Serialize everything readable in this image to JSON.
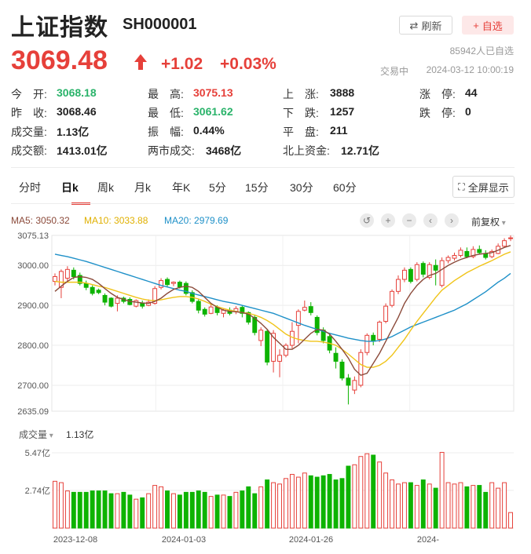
{
  "header": {
    "title": "上证指数",
    "code": "SH000001",
    "refresh_label": "刷新",
    "fav_label": "自选",
    "subscribers": "85942人已自选"
  },
  "quote": {
    "price": "3069.48",
    "change": "+1.02",
    "change_pct": "+0.03%",
    "status": "交易中",
    "timestamp": "2024-03-12 10:00:19"
  },
  "stats": [
    [
      {
        "label": "今　开:",
        "value": "3068.18",
        "color": "dn"
      },
      {
        "label": "最　高:",
        "value": "3075.13",
        "color": "up"
      },
      {
        "label": "上　涨:",
        "value": "3888",
        "color": ""
      },
      {
        "label": "涨　停:",
        "value": "44",
        "color": ""
      }
    ],
    [
      {
        "label": "昨　收:",
        "value": "3068.46",
        "color": ""
      },
      {
        "label": "最　低:",
        "value": "3061.62",
        "color": "dn"
      },
      {
        "label": "下　跌:",
        "value": "1257",
        "color": ""
      },
      {
        "label": "跌　停:",
        "value": "0",
        "color": ""
      }
    ],
    [
      {
        "label": "成交量:",
        "value": "1.13亿",
        "color": ""
      },
      {
        "label": "振　幅:",
        "value": "0.44%",
        "color": ""
      },
      {
        "label": "平　盘:",
        "value": "211",
        "color": ""
      }
    ],
    [
      {
        "label": "成交额:",
        "value": "1413.01亿",
        "color": ""
      },
      {
        "label": "两市成交:",
        "value": "3468亿",
        "color": ""
      },
      {
        "label": "北上资金:",
        "value": "12.71亿",
        "color": ""
      }
    ]
  ],
  "tabs": [
    "分时",
    "日k",
    "周k",
    "月k",
    "年K",
    "5分",
    "15分",
    "30分",
    "60分"
  ],
  "active_tab": "日k",
  "fullscreen_label": "全屏显示",
  "ma": {
    "ma5": "MA5: 3050.32",
    "ma10": "MA10: 3033.88",
    "ma20": "MA20: 2979.69"
  },
  "adjust_label": "前复权",
  "volume_label": "成交量",
  "volume_value": "1.13亿",
  "colors": {
    "up": "#e6403a",
    "down": "#0db300",
    "ma5": "#8b4a3a",
    "ma10": "#f0c419",
    "ma20": "#1e90c8"
  },
  "chart_data": {
    "type": "candlestick",
    "ylim": [
      2635.09,
      3075.13
    ],
    "y_ticks": [
      "3075.13",
      "3000.00",
      "2900.00",
      "2800.00",
      "2700.00",
      "2635.09"
    ],
    "x_ticks": [
      "2023-12-08",
      "2024-01-03",
      "2024-01-26",
      "2024-"
    ],
    "volume_ticks": [
      "5.47亿",
      "2.74亿"
    ],
    "volume_ylim": [
      0,
      5.47
    ],
    "candles": [
      {
        "o": 2960,
        "c": 2972,
        "h": 2980,
        "l": 2950,
        "v": 3.4
      },
      {
        "o": 2945,
        "c": 2985,
        "h": 2990,
        "l": 2918,
        "v": 3.3
      },
      {
        "o": 2968,
        "c": 2990,
        "h": 2998,
        "l": 2958,
        "v": 2.7
      },
      {
        "o": 2988,
        "c": 2972,
        "h": 2995,
        "l": 2965,
        "v": 2.6
      },
      {
        "o": 2975,
        "c": 2955,
        "h": 2982,
        "l": 2950,
        "v": 2.6
      },
      {
        "o": 2955,
        "c": 2945,
        "h": 2962,
        "l": 2938,
        "v": 2.6
      },
      {
        "o": 2945,
        "c": 2930,
        "h": 2950,
        "l": 2925,
        "v": 2.7
      },
      {
        "o": 2938,
        "c": 2932,
        "h": 2942,
        "l": 2928,
        "v": 2.7
      },
      {
        "o": 2925,
        "c": 2908,
        "h": 2930,
        "l": 2900,
        "v": 2.7
      },
      {
        "o": 2918,
        "c": 2898,
        "h": 2920,
        "l": 2895,
        "v": 2.5
      },
      {
        "o": 2905,
        "c": 2918,
        "h": 2925,
        "l": 2885,
        "v": 2.5
      },
      {
        "o": 2918,
        "c": 2910,
        "h": 2922,
        "l": 2905,
        "v": 2.6
      },
      {
        "o": 2915,
        "c": 2902,
        "h": 2920,
        "l": 2900,
        "v": 2.4
      },
      {
        "o": 2898,
        "c": 2912,
        "h": 2915,
        "l": 2895,
        "v": 2.1
      },
      {
        "o": 2906,
        "c": 2898,
        "h": 2912,
        "l": 2892,
        "v": 2.2
      },
      {
        "o": 2900,
        "c": 2908,
        "h": 2915,
        "l": 2898,
        "v": 2.5
      },
      {
        "o": 2905,
        "c": 2942,
        "h": 2948,
        "l": 2902,
        "v": 3.1
      },
      {
        "o": 2945,
        "c": 2962,
        "h": 2968,
        "l": 2940,
        "v": 3.0
      },
      {
        "o": 2965,
        "c": 2952,
        "h": 2970,
        "l": 2945,
        "v": 2.7
      },
      {
        "o": 2955,
        "c": 2958,
        "h": 2960,
        "l": 2948,
        "v": 2.5
      },
      {
        "o": 2958,
        "c": 2946,
        "h": 2962,
        "l": 2942,
        "v": 2.4
      },
      {
        "o": 2955,
        "c": 2930,
        "h": 2960,
        "l": 2925,
        "v": 2.6
      },
      {
        "o": 2932,
        "c": 2910,
        "h": 2938,
        "l": 2905,
        "v": 2.6
      },
      {
        "o": 2910,
        "c": 2888,
        "h": 2915,
        "l": 2880,
        "v": 2.7
      },
      {
        "o": 2890,
        "c": 2878,
        "h": 2895,
        "l": 2872,
        "v": 2.6
      },
      {
        "o": 2880,
        "c": 2896,
        "h": 2905,
        "l": 2878,
        "v": 2.3
      },
      {
        "o": 2895,
        "c": 2882,
        "h": 2900,
        "l": 2875,
        "v": 2.4
      },
      {
        "o": 2880,
        "c": 2888,
        "h": 2892,
        "l": 2870,
        "v": 2.4
      },
      {
        "o": 2888,
        "c": 2880,
        "h": 2895,
        "l": 2875,
        "v": 2.3
      },
      {
        "o": 2885,
        "c": 2892,
        "h": 2898,
        "l": 2878,
        "v": 2.6
      },
      {
        "o": 2895,
        "c": 2880,
        "h": 2900,
        "l": 2870,
        "v": 2.7
      },
      {
        "o": 2882,
        "c": 2858,
        "h": 2885,
        "l": 2852,
        "v": 3.0
      },
      {
        "o": 2870,
        "c": 2832,
        "h": 2875,
        "l": 2825,
        "v": 2.5
      },
      {
        "o": 2812,
        "c": 2838,
        "h": 2845,
        "l": 2798,
        "v": 3.0
      },
      {
        "o": 2835,
        "c": 2758,
        "h": 2840,
        "l": 2750,
        "v": 3.5
      },
      {
        "o": 2760,
        "c": 2830,
        "h": 2838,
        "l": 2732,
        "v": 3.3
      },
      {
        "o": 2760,
        "c": 2775,
        "h": 2790,
        "l": 2720,
        "v": 3.2
      },
      {
        "o": 2775,
        "c": 2800,
        "h": 2805,
        "l": 2770,
        "v": 3.6
      },
      {
        "o": 2800,
        "c": 2835,
        "h": 2858,
        "l": 2792,
        "v": 3.9
      },
      {
        "o": 2850,
        "c": 2885,
        "h": 2890,
        "l": 2805,
        "v": 3.7
      },
      {
        "o": 2888,
        "c": 2895,
        "h": 2912,
        "l": 2885,
        "v": 4.0
      },
      {
        "o": 2897,
        "c": 2882,
        "h": 2908,
        "l": 2875,
        "v": 3.8
      },
      {
        "o": 2870,
        "c": 2832,
        "h": 2875,
        "l": 2825,
        "v": 3.7
      },
      {
        "o": 2838,
        "c": 2812,
        "h": 2845,
        "l": 2805,
        "v": 3.8
      },
      {
        "o": 2822,
        "c": 2788,
        "h": 2828,
        "l": 2780,
        "v": 3.9
      },
      {
        "o": 2780,
        "c": 2760,
        "h": 2795,
        "l": 2742,
        "v": 3.5
      },
      {
        "o": 2758,
        "c": 2718,
        "h": 2765,
        "l": 2712,
        "v": 3.6
      },
      {
        "o": 2718,
        "c": 2700,
        "h": 2728,
        "l": 2652,
        "v": 4.5
      },
      {
        "o": 2688,
        "c": 2712,
        "h": 2722,
        "l": 2678,
        "v": 4.6
      },
      {
        "o": 2700,
        "c": 2782,
        "h": 2790,
        "l": 2695,
        "v": 5.2
      },
      {
        "o": 2782,
        "c": 2825,
        "h": 2830,
        "l": 2775,
        "v": 5.4
      },
      {
        "o": 2825,
        "c": 2810,
        "h": 2832,
        "l": 2800,
        "v": 5.3
      },
      {
        "o": 2815,
        "c": 2858,
        "h": 2862,
        "l": 2808,
        "v": 4.8
      },
      {
        "o": 2860,
        "c": 2898,
        "h": 2905,
        "l": 2855,
        "v": 4.0
      },
      {
        "o": 2900,
        "c": 2935,
        "h": 2940,
        "l": 2895,
        "v": 3.5
      },
      {
        "o": 2935,
        "c": 2965,
        "h": 2975,
        "l": 2928,
        "v": 3.2
      },
      {
        "o": 2965,
        "c": 2988,
        "h": 2995,
        "l": 2958,
        "v": 3.3
      },
      {
        "o": 2990,
        "c": 2960,
        "h": 2995,
        "l": 2955,
        "v": 3.3
      },
      {
        "o": 2965,
        "c": 3002,
        "h": 3008,
        "l": 2960,
        "v": 3.1
      },
      {
        "o": 3005,
        "c": 2978,
        "h": 3010,
        "l": 2970,
        "v": 3.5
      },
      {
        "o": 2970,
        "c": 3002,
        "h": 3008,
        "l": 2965,
        "v": 3.2
      },
      {
        "o": 3000,
        "c": 2988,
        "h": 3015,
        "l": 2950,
        "v": 2.9
      },
      {
        "o": 2950,
        "c": 3012,
        "h": 3020,
        "l": 2945,
        "v": 5.5
      },
      {
        "o": 3012,
        "c": 3020,
        "h": 3025,
        "l": 3005,
        "v": 3.3
      },
      {
        "o": 3018,
        "c": 3025,
        "h": 3032,
        "l": 3012,
        "v": 3.2
      },
      {
        "o": 3025,
        "c": 3038,
        "h": 3045,
        "l": 3020,
        "v": 3.3
      },
      {
        "o": 3035,
        "c": 3022,
        "h": 3045,
        "l": 3018,
        "v": 3.0
      },
      {
        "o": 3022,
        "c": 3040,
        "h": 3048,
        "l": 3018,
        "v": 3.1
      },
      {
        "o": 3040,
        "c": 3032,
        "h": 3050,
        "l": 3028,
        "v": 3.1
      },
      {
        "o": 3030,
        "c": 3020,
        "h": 3038,
        "l": 3015,
        "v": 2.6
      },
      {
        "o": 3022,
        "c": 3035,
        "h": 3040,
        "l": 3018,
        "v": 3.3
      },
      {
        "o": 3030,
        "c": 3048,
        "h": 3055,
        "l": 3028,
        "v": 2.9
      },
      {
        "o": 3048,
        "c": 3062,
        "h": 3068,
        "l": 3045,
        "v": 3.3
      },
      {
        "o": 3068,
        "c": 3069,
        "h": 3075,
        "l": 3061,
        "v": 1.13
      }
    ],
    "ma5": [
      2935,
      2948,
      2960,
      2970,
      2972,
      2970,
      2965,
      2955,
      2942,
      2930,
      2920,
      2915,
      2910,
      2908,
      2906,
      2905,
      2910,
      2918,
      2930,
      2940,
      2945,
      2948,
      2945,
      2935,
      2920,
      2905,
      2895,
      2888,
      2885,
      2884,
      2882,
      2878,
      2868,
      2855,
      2840,
      2820,
      2805,
      2790,
      2790,
      2800,
      2815,
      2830,
      2840,
      2838,
      2828,
      2810,
      2790,
      2768,
      2740,
      2725,
      2730,
      2755,
      2780,
      2810,
      2840,
      2870,
      2905,
      2930,
      2950,
      2965,
      2975,
      2980,
      2990,
      3000,
      3008,
      3015,
      3020,
      3025,
      3028,
      3030,
      3032,
      3038,
      3045,
      3050
    ],
    "ma10": [
      2960,
      2958,
      2958,
      2958,
      2958,
      2956,
      2952,
      2948,
      2945,
      2940,
      2935,
      2930,
      2925,
      2920,
      2916,
      2913,
      2912,
      2914,
      2917,
      2920,
      2922,
      2922,
      2920,
      2916,
      2910,
      2903,
      2897,
      2892,
      2888,
      2885,
      2882,
      2880,
      2876,
      2870,
      2862,
      2852,
      2840,
      2828,
      2820,
      2815,
      2812,
      2810,
      2810,
      2808,
      2805,
      2800,
      2790,
      2778,
      2765,
      2752,
      2745,
      2745,
      2750,
      2760,
      2775,
      2795,
      2815,
      2838,
      2860,
      2880,
      2900,
      2920,
      2938,
      2950,
      2962,
      2972,
      2982,
      2990,
      2998,
      3005,
      3012,
      3020,
      3028,
      3034
    ],
    "ma20": [
      3028,
      3025,
      3022,
      3018,
      3014,
      3010,
      3005,
      3000,
      2995,
      2990,
      2985,
      2980,
      2975,
      2970,
      2965,
      2960,
      2955,
      2950,
      2946,
      2942,
      2938,
      2935,
      2930,
      2926,
      2922,
      2918,
      2914,
      2910,
      2907,
      2904,
      2900,
      2896,
      2892,
      2888,
      2884,
      2880,
      2874,
      2868,
      2862,
      2856,
      2850,
      2845,
      2840,
      2835,
      2830,
      2826,
      2822,
      2818,
      2815,
      2812,
      2810,
      2810,
      2812,
      2816,
      2822,
      2830,
      2838,
      2846,
      2852,
      2858,
      2864,
      2870,
      2876,
      2882,
      2888,
      2896,
      2904,
      2914,
      2924,
      2934,
      2946,
      2958,
      2968,
      2980
    ]
  }
}
